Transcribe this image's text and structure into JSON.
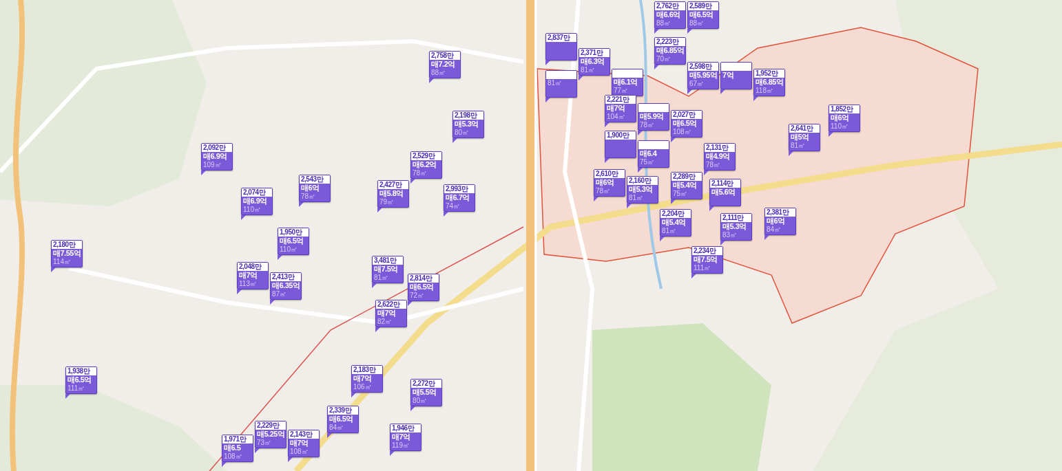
{
  "markers": [
    {
      "price_per_area": "2,092만",
      "price": "매6.9억",
      "area": "109㎡"
    },
    {
      "price_per_area": "2,074만",
      "price": "매6.9억",
      "area": "110㎡"
    },
    {
      "price_per_area": "2,543만",
      "price": "매6억",
      "area": "78㎡"
    },
    {
      "price_per_area": "1,950만",
      "price": "매6.5억",
      "area": "110㎡"
    },
    {
      "price_per_area": "2,180만",
      "price": "매7.55억",
      "area": "114㎡"
    },
    {
      "price_per_area": "2,048만",
      "price": "매7억",
      "area": "113㎡"
    },
    {
      "price_per_area": "2,413만",
      "price": "매6.35억",
      "area": "87㎡"
    },
    {
      "price_per_area": "1,938만",
      "price": "매6.5억",
      "area": "111㎡"
    },
    {
      "price_per_area": "1,971만",
      "price": "매6.5",
      "area": "108㎡"
    },
    {
      "price_per_area": "2,229만",
      "price": "매5.25억",
      "area": "73㎡"
    },
    {
      "price_per_area": "2,143만",
      "price": "매7억",
      "area": "108㎡"
    },
    {
      "price_per_area": "2,758만",
      "price": "매7.2억",
      "area": "88㎡"
    },
    {
      "price_per_area": "2,198만",
      "price": "매5.3억",
      "area": "80㎡"
    },
    {
      "price_per_area": "2,427만",
      "price": "매5.8억",
      "area": "79㎡"
    },
    {
      "price_per_area": "2,529만",
      "price": "매6.2억",
      "area": "78㎡"
    },
    {
      "price_per_area": "2,993만",
      "price": "매6.7억",
      "area": "74㎡"
    },
    {
      "price_per_area": "3,481만",
      "price": "매7.5억",
      "area": "81㎡"
    },
    {
      "price_per_area": "2,814만",
      "price": "매6.5억",
      "area": "72㎡"
    },
    {
      "price_per_area": "2,622만",
      "price": "매7억",
      "area": "82㎡"
    },
    {
      "price_per_area": "2,183만",
      "price": "매7억",
      "area": "106㎡"
    },
    {
      "price_per_area": "2,272만",
      "price": "매5.5억",
      "area": "80㎡"
    },
    {
      "price_per_area": "2,339만",
      "price": "매6.5억",
      "area": "84㎡"
    },
    {
      "price_per_area": "1,946만",
      "price": "매7억",
      "area": "119㎡"
    },
    {
      "price_per_area": "2,837만"
    },
    {
      "area": "81㎡"
    },
    {
      "price_per_area": "2,371만",
      "price": "매6.3억",
      "area": "81㎡"
    },
    {
      "price": "매6.1억",
      "area": "77㎡"
    },
    {
      "price_per_area": "2,762만",
      "price": "매6.6억",
      "area": "88㎡"
    },
    {
      "price_per_area": "2,589만",
      "price": "매6.5억",
      "area": "88㎡"
    },
    {
      "price_per_area": "2,223만",
      "price": "매6.85억",
      "area": "70㎡"
    },
    {
      "price_per_area": "2,598만",
      "price": "매5.95억",
      "area": "67㎡"
    },
    {
      "price": "7억"
    },
    {
      "price_per_area": "1,952만",
      "price": "매6.85억",
      "area": "118㎡"
    },
    {
      "price_per_area": "2,221만",
      "price": "매7억",
      "area": "104㎡"
    },
    {
      "price": "매5.9억",
      "area": "78㎡"
    },
    {
      "price_per_area": "2,027만",
      "price": "매6.5억",
      "area": "108㎡"
    },
    {
      "price_per_area": "1,900만"
    },
    {
      "price": "매6.4",
      "area": "75㎡"
    },
    {
      "price_per_area": "2,131만",
      "price": "매4.9억",
      "area": "78㎡"
    },
    {
      "price_per_area": "2,610만",
      "price": "매6억",
      "area": "78㎡"
    },
    {
      "price_per_area": "2,160만",
      "price": "매5.3억",
      "area": "81㎡"
    },
    {
      "price_per_area": "2,289만",
      "price": "매5.4억",
      "area": "75㎡"
    },
    {
      "price_per_area": "2,114만",
      "price": "매5.6억"
    },
    {
      "price_per_area": "2,204만",
      "price": "매5.4억",
      "area": "81㎡"
    },
    {
      "price_per_area": "2,111만",
      "price": "매5.3억",
      "area": "83㎡"
    },
    {
      "price_per_area": "2,234만",
      "price": "매7.5억",
      "area": "111㎡"
    },
    {
      "price_per_area": "2,381만",
      "price": "매6억",
      "area": "84㎡"
    },
    {
      "price_per_area": "2,641만",
      "price": "매5억",
      "area": "81㎡"
    },
    {
      "price_per_area": "1,852만",
      "price": "매6억",
      "area": "110㎡"
    }
  ]
}
